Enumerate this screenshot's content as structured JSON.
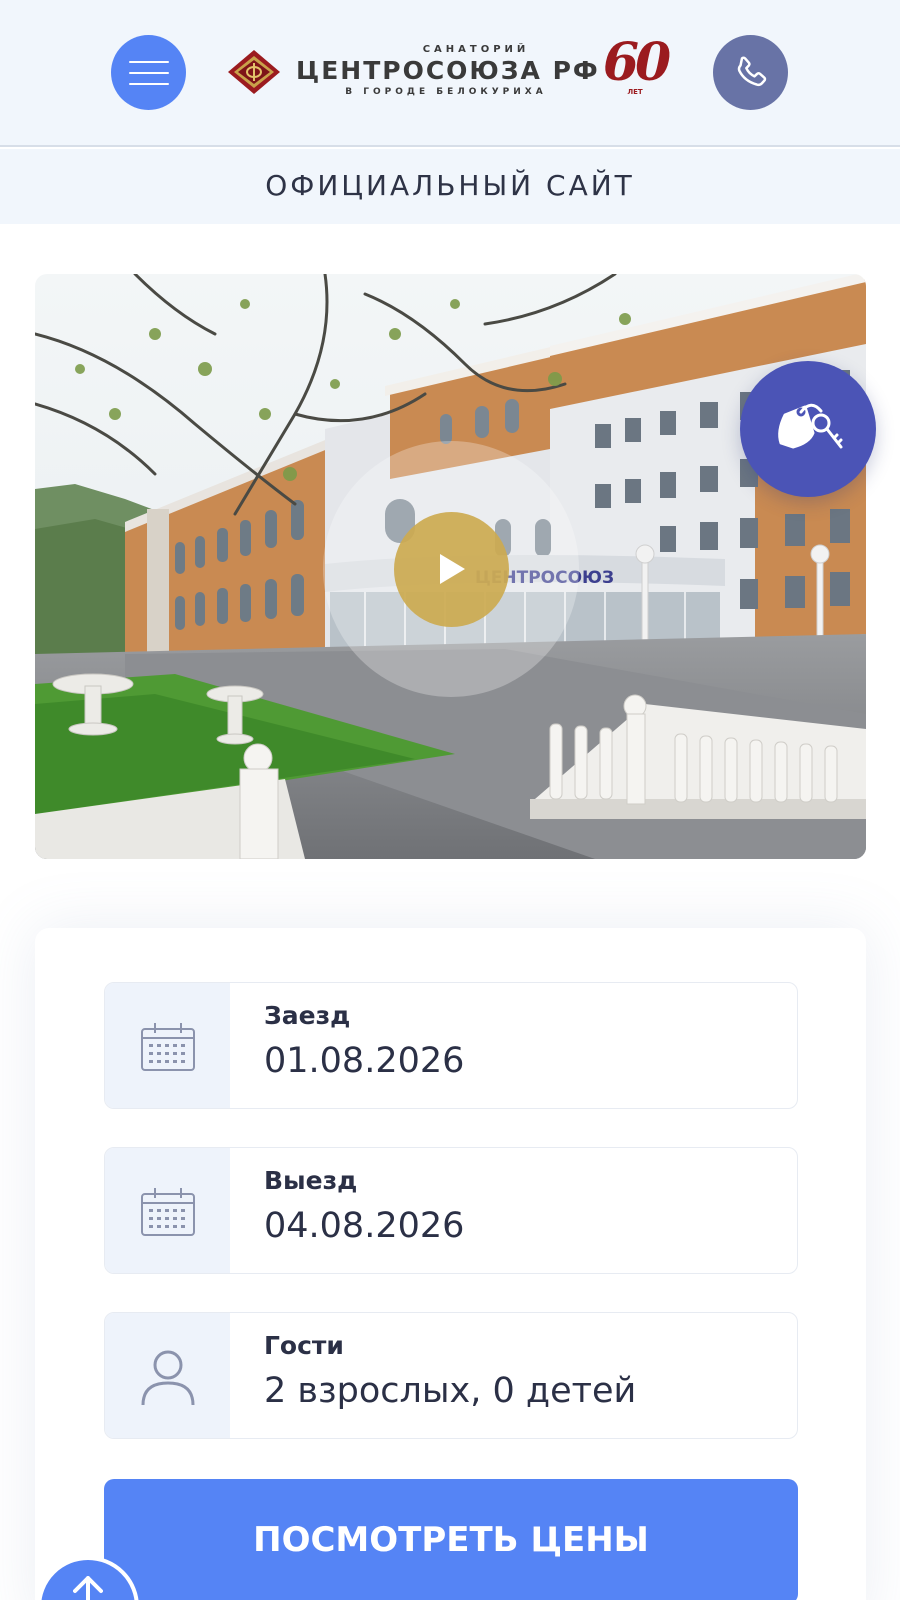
{
  "header": {
    "menu_icon": "hamburger-menu-icon",
    "phone_icon": "phone-icon",
    "logo": {
      "top_line": "САНАТОРИЙ",
      "main_line": "ЦЕНТРОСОЮЗА РФ",
      "bottom_line": "В ГОРОДЕ БЕЛОКУРИХА",
      "anniversary_number": "60",
      "anniversary_label": "ЛЕТ"
    },
    "subtitle": "ОФИЦИАЛЬНЫЙ САЙТ"
  },
  "hero": {
    "photo_sign": "ЦЕНТРОСОЮЗ",
    "play_icon": "play-icon",
    "booking_icon": "keys-icon"
  },
  "booking": {
    "checkin": {
      "label": "Заезд",
      "value": "01.08.2026",
      "icon": "calendar-icon"
    },
    "checkout": {
      "label": "Выезд",
      "value": "04.08.2026",
      "icon": "calendar-icon"
    },
    "guests": {
      "label": "Гости",
      "value": "2 взрослых, 0 детей",
      "icon": "person-icon"
    },
    "submit_label": "ПОСМОТРЕТЬ ЦЕНЫ"
  },
  "scroll_top_icon": "arrow-up-icon",
  "colors": {
    "accent": "#5584f5",
    "header_bg": "#f1f6fc",
    "phone_button": "#6873a6",
    "booking_button": "#4b54b6",
    "brand_red": "#9b1b1f",
    "text": "#2b3046"
  }
}
